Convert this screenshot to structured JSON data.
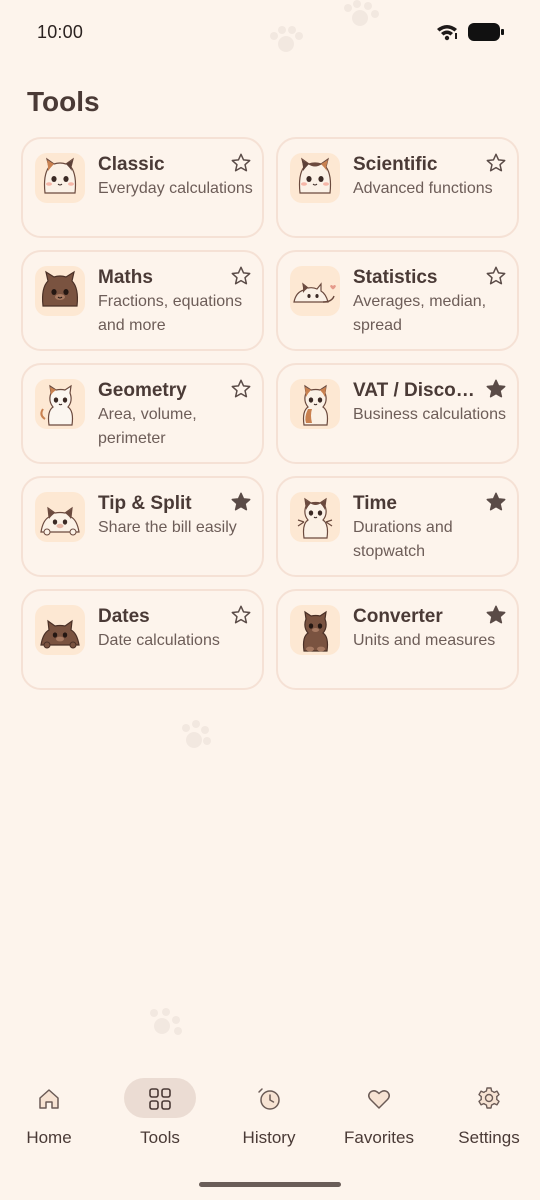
{
  "status_bar": {
    "time": "10:00"
  },
  "page": {
    "title": "Tools"
  },
  "tools": [
    {
      "title": "Classic",
      "description": "Everyday calculations",
      "favorite": false,
      "icon": "calico-cat-icon"
    },
    {
      "title": "Scientific",
      "description": "Advanced functions",
      "favorite": false,
      "icon": "calico-cat-icon"
    },
    {
      "title": "Maths",
      "description": "Fractions, equations and more",
      "favorite": false,
      "icon": "brown-cat-icon"
    },
    {
      "title": "Statistics",
      "description": "Averages, median, spread",
      "favorite": false,
      "icon": "lying-cat-icon"
    },
    {
      "title": "Geometry",
      "description": "Area, volume, perimeter",
      "favorite": false,
      "icon": "white-cat-icon"
    },
    {
      "title": "VAT / Discounts",
      "description": "Business calculations",
      "favorite": true,
      "icon": "calico-cat-icon"
    },
    {
      "title": "Tip & Split",
      "description": "Share the bill easily",
      "favorite": true,
      "icon": "tabby-cat-icon"
    },
    {
      "title": "Time",
      "description": "Durations and stopwatch",
      "favorite": true,
      "icon": "tabby-cat-icon"
    },
    {
      "title": "Dates",
      "description": "Date calculations",
      "favorite": false,
      "icon": "brown-cat-icon"
    },
    {
      "title": "Converter",
      "description": "Units and measures",
      "favorite": true,
      "icon": "brown-cat-icon"
    }
  ],
  "nav": [
    {
      "label": "Home",
      "icon": "home-icon",
      "active": false
    },
    {
      "label": "Tools",
      "icon": "grid-icon",
      "active": true
    },
    {
      "label": "History",
      "icon": "clock-icon",
      "active": false
    },
    {
      "label": "Favorites",
      "icon": "heart-icon",
      "active": false
    },
    {
      "label": "Settings",
      "icon": "gear-icon",
      "active": false
    }
  ],
  "colors": {
    "background": "#fdf4ec",
    "card_border": "#f5e1d5",
    "icon_tile": "#fde8d3",
    "text": "#4a3a36",
    "active_pill": "#ebdcd3"
  }
}
